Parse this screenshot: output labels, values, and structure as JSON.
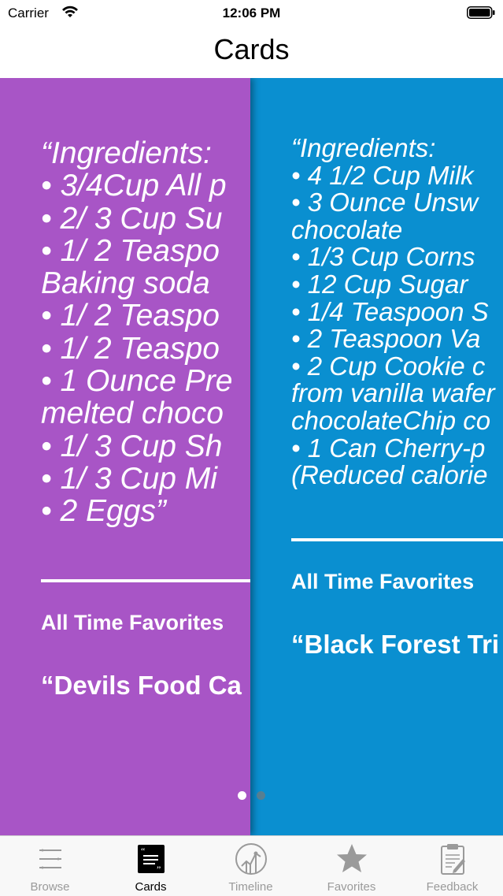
{
  "status_bar": {
    "carrier": "Carrier",
    "time": "12:06 PM"
  },
  "nav": {
    "title": "Cards"
  },
  "cards": [
    {
      "ingredients": "“Ingredients:\n• 3/4Cup All p\n• 2/ 3 Cup Su\n• 1/ 2 Teaspo\nBaking soda\n• 1/ 2 Teaspo\n• 1/ 2 Teaspo\n• 1 Ounce Pre\nmelted choco\n• 1/ 3 Cup Sh\n• 1/ 3 Cup Mi\n• 2 Eggs”",
      "category": "All Time Favorites",
      "title": "“Devils Food Ca",
      "color": "#a855c6"
    },
    {
      "ingredients": "“Ingredients:\n• 4 1/2 Cup Milk\n• 3 Ounce Unsw\nchocolate\n• 1/3 Cup Corns\n• 12 Cup Sugar\n• 1/4 Teaspoon S\n• 2 Teaspoon Va\n• 2 Cup Cookie c\nfrom vanilla wafer\nchocolateChip co\n• 1 Can Cherry-p\n(Reduced calorie",
      "category": "All Time Favorites",
      "title": "“Black Forest Tri",
      "color": "#0a8fd0"
    }
  ],
  "page_indicator": {
    "current": 1,
    "total": 2
  },
  "tabs": [
    {
      "label": "Browse",
      "icon": "list-icon",
      "active": false
    },
    {
      "label": "Cards",
      "icon": "quote-card-icon",
      "active": true
    },
    {
      "label": "Timeline",
      "icon": "timeline-chart-icon",
      "active": false
    },
    {
      "label": "Favorites",
      "icon": "star-icon",
      "active": false
    },
    {
      "label": "Feedback",
      "icon": "clipboard-icon",
      "active": false
    }
  ]
}
